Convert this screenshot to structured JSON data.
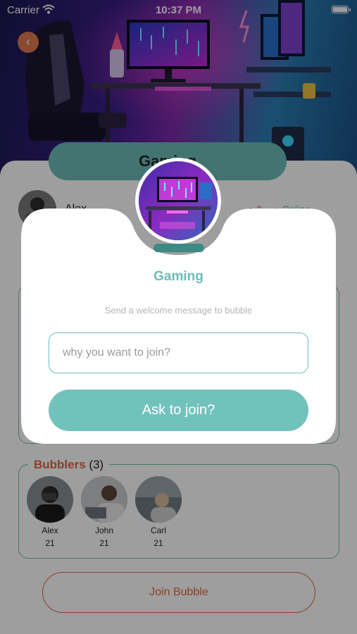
{
  "status_bar": {
    "carrier": "Carrier",
    "time": "10:37 PM"
  },
  "header": {
    "back_icon": "chevron-left-icon"
  },
  "page": {
    "title": "Gaming",
    "owner_name": "Alex",
    "stat_count": "0",
    "online_label": "Online"
  },
  "bubblers": {
    "title": "Bubblers",
    "count": "(3)",
    "members": [
      {
        "name": "Alex",
        "age": "21"
      },
      {
        "name": "John",
        "age": "21"
      },
      {
        "name": "Carl",
        "age": "21"
      }
    ]
  },
  "join_bubble_label": "Join Bubble",
  "modal": {
    "title": "Gaming",
    "subtitle": "Send a welcome message to bubble",
    "input_placeholder": "why you want to join?",
    "button_label": "Ask to join?"
  },
  "colors": {
    "accent": "#6bbdb7",
    "button": "#72c2bc",
    "orange": "#e0643f"
  }
}
